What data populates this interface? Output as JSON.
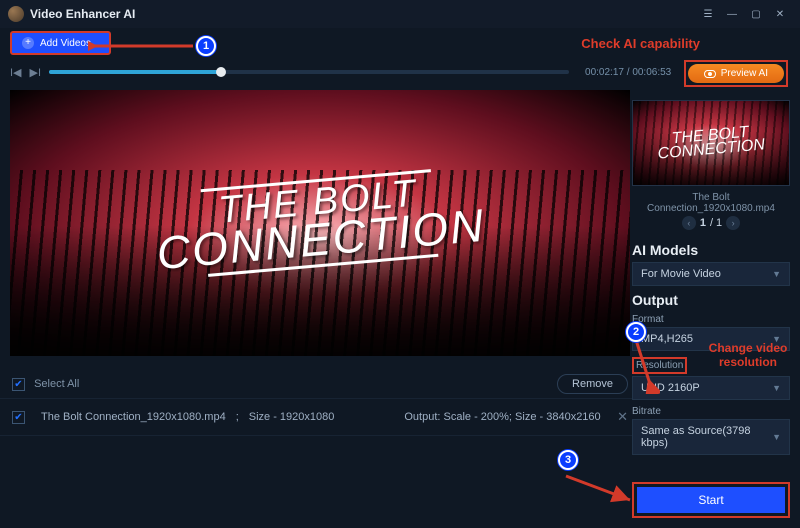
{
  "titlebar": {
    "title": "Video Enhancer AI"
  },
  "toolbar": {
    "add_videos_label": "Add Videos..."
  },
  "annotations": {
    "check_ai": "Check AI capability",
    "change_res": "Change video resolution",
    "n1": "1",
    "n2": "2",
    "n3": "3"
  },
  "preview_ai": {
    "label": "Preview AI"
  },
  "playback": {
    "time_current": "00:02:17",
    "time_total": "00:06:53"
  },
  "poster": {
    "line1": "THE BOLT",
    "line2": "CONNECTION"
  },
  "file_list": {
    "select_all_label": "Select All",
    "remove_label": "Remove",
    "item": {
      "name": "The Bolt Connection_1920x1080.mp4",
      "size_label": "Size - 1920x1080",
      "output_label": "Output: Scale - 200%; Size - 3840x2160"
    }
  },
  "panel": {
    "thumb_name": "The Bolt Connection_1920x1080.mp4",
    "thumb_index": "1",
    "thumb_total": "/ 1",
    "ai_models_h": "AI Models",
    "ai_model_value": "For Movie Video",
    "output_h": "Output",
    "format_label": "Format",
    "format_value": "MP4,H265",
    "resolution_label": "Resolution",
    "resolution_value": "UHD 2160P",
    "bitrate_label": "Bitrate",
    "bitrate_value": "Same as Source(3798 kbps)",
    "start_label": "Start"
  }
}
